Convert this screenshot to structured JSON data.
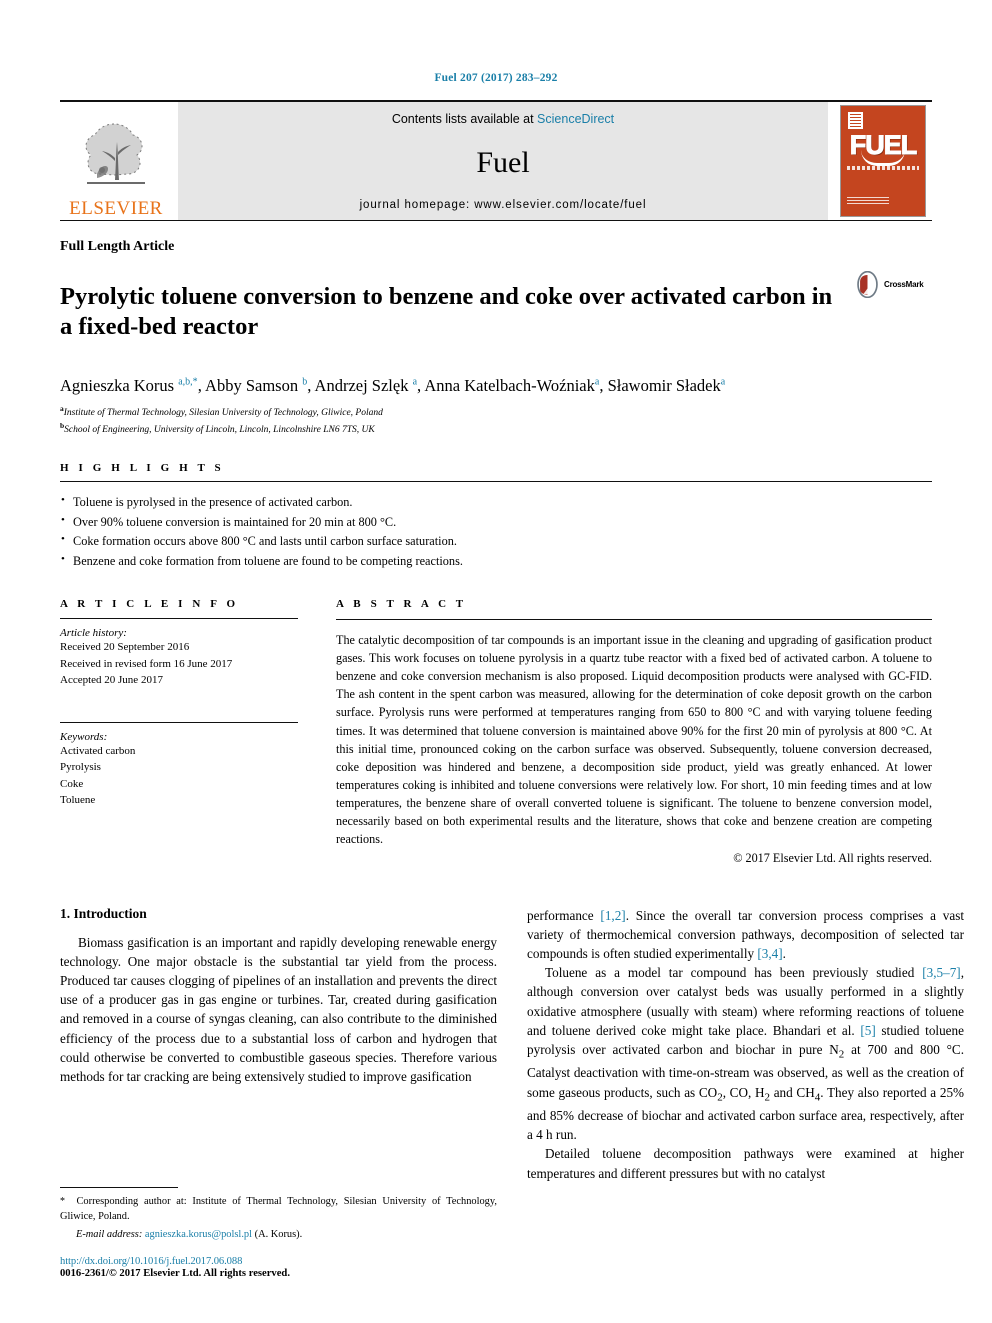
{
  "running_head": "Fuel 207 (2017) 283–292",
  "masthead": {
    "contents_prefix": "Contents lists available at ",
    "sciencedirect": "ScienceDirect",
    "journal_name": "Fuel",
    "homepage": "journal homepage: www.elsevier.com/locate/fuel",
    "publisher_wordmark": "ELSEVIER",
    "cover_title": "FUEL",
    "accent_link_color": "#1a7fa8",
    "publisher_orange": "#E8731A",
    "cover_background": "#C4451F"
  },
  "article": {
    "type_label": "Full Length Article",
    "title": "Pyrolytic toluene conversion to benzene and coke over activated carbon in a fixed-bed reactor",
    "crossmark_label": "CrossMark",
    "authors_html": "Agnieszka Korus <sup>a,b,*</sup>, Abby Samson <sup>b</sup>, Andrzej Szlęk <sup>a</sup>, Anna Katelbach-Woźniak<sup>a</sup>, Sławomir Sładek<sup>a</sup>",
    "affiliations": [
      {
        "marker": "a",
        "text": "Institute of Thermal Technology, Silesian University of Technology, Gliwice, Poland"
      },
      {
        "marker": "b",
        "text": "School of Engineering, University of Lincoln, Lincoln, Lincolnshire LN6 7TS, UK"
      }
    ]
  },
  "highlights": {
    "heading": "H I G H L I G H T S",
    "items": [
      "Toluene is pyrolysed in the presence of activated carbon.",
      "Over 90% toluene conversion is maintained for 20 min at 800 °C.",
      "Coke formation occurs above 800 °C and lasts until carbon surface saturation.",
      "Benzene and coke formation from toluene are found to be competing reactions."
    ]
  },
  "article_info": {
    "heading": "A R T I C L E    I N F O",
    "history_title": "Article history:",
    "history": [
      "Received 20 September 2016",
      "Received in revised form 16 June 2017",
      "Accepted 20 June 2017"
    ],
    "keywords_title": "Keywords:",
    "keywords": [
      "Activated carbon",
      "Pyrolysis",
      "Coke",
      "Toluene"
    ]
  },
  "abstract": {
    "heading": "A B S T R A C T",
    "text": "The catalytic decomposition of tar compounds is an important issue in the cleaning and upgrading of gasification product gases. This work focuses on toluene pyrolysis in a quartz tube reactor with a fixed bed of activated carbon. A toluene to benzene and coke conversion mechanism is also proposed. Liquid decomposition products were analysed with GC-FID. The ash content in the spent carbon was measured, allowing for the determination of coke deposit growth on the carbon surface. Pyrolysis runs were performed at temperatures ranging from 650 to 800 °C and with varying toluene feeding times. It was determined that toluene conversion is maintained above 90% for the first 20 min of pyrolysis at 800 °C. At this initial time, pronounced coking on the carbon surface was observed. Subsequently, toluene conversion decreased, coke deposition was hindered and benzene, a decomposition side product, yield was greatly enhanced. At lower temperatures coking is inhibited and toluene conversions were relatively low. For short, 10 min feeding times and at low temperatures, the benzene share of overall converted toluene is significant. The toluene to benzene conversion model, necessarily based on both experimental results and the literature, shows that coke and benzene creation are competing reactions.",
    "copyright": "© 2017 Elsevier Ltd. All rights reserved."
  },
  "introduction": {
    "heading": "1. Introduction",
    "left_paragraph": "Biomass gasification is an important and rapidly developing renewable energy technology. One major obstacle is the substantial tar yield from the process. Produced tar causes clogging of pipelines of an installation and prevents the direct use of a producer gas in gas engine or turbines. Tar, created during gasification and removed in a course of syngas cleaning, can also contribute to the diminished efficiency of the process due to a substantial loss of carbon and hydrogen that could otherwise be converted to combustible gaseous species. Therefore various methods for tar cracking are being extensively studied to improve gasification",
    "right_paragraph_1_html": "performance <span class=\"lnk\">[1,2]</span>. Since the overall tar conversion process comprises a vast variety of thermochemical conversion pathways, decomposition of selected tar compounds is often studied experimentally <span class=\"lnk\">[3,4]</span>.",
    "right_paragraph_2_html": "Toluene as a model tar compound has been previously studied <span class=\"lnk\">[3,5&ndash;7]</span>, although conversion over catalyst beds was usually performed in a slightly oxidative atmosphere (usually with steam) where reforming reactions of toluene and toluene derived coke might take place. Bhandari et al. <span class=\"lnk\">[5]</span> studied toluene pyrolysis over activated carbon and biochar in pure N<sub>2</sub> at 700 and 800 °C. Catalyst deactivation with time-on-stream was observed, as well as the creation of some gaseous products, such as CO<sub>2</sub>, CO, H<sub>2</sub> and CH<sub>4</sub>. They also reported a 25% and 85% decrease of biochar and activated carbon surface area, respectively, after a 4 h run.",
    "right_paragraph_3": "Detailed toluene decomposition pathways were examined at higher temperatures and different pressures but with no catalyst"
  },
  "footnotes": {
    "corresponding_html": "<span class=\"star\">*</span>&nbsp; Corresponding author at: Institute of Thermal Technology, Silesian University of Technology, Gliwice, Poland.",
    "email_label": "E-mail address:",
    "email": "agnieszka.korus@polsl.pl",
    "email_suffix": "(A. Korus).",
    "doi": "http://dx.doi.org/10.1016/j.fuel.2017.06.088",
    "issn_line": "0016-2361/© 2017 Elsevier Ltd. All rights reserved."
  }
}
